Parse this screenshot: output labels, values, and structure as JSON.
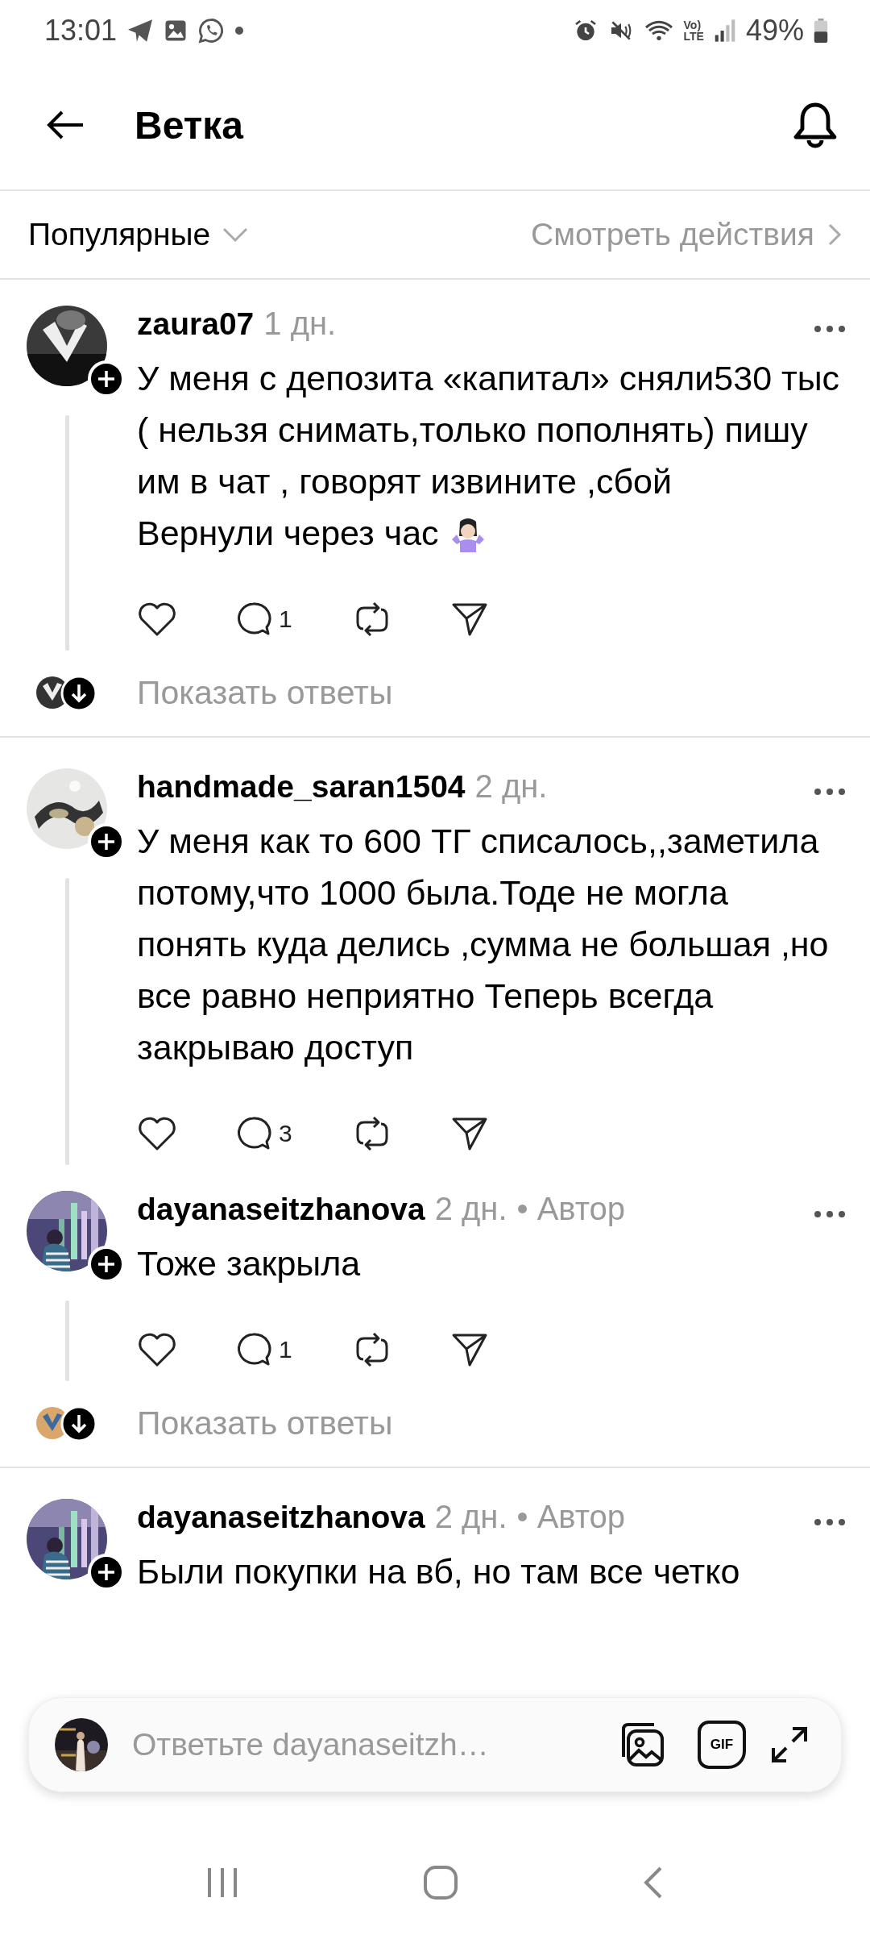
{
  "status_bar": {
    "time": "13:01",
    "network_top": "Vo)",
    "network_bottom": "LTE",
    "battery": "49%"
  },
  "header": {
    "title": "Ветка"
  },
  "sort_bar": {
    "sort_label": "Популярные",
    "activity_link": "Смотреть действия"
  },
  "comments": [
    {
      "username": "zaura07",
      "time": "1 дн.",
      "text": "У меня с депозита «капитал» сняли530 тыс ( нельзя снимать,только пополнять) пишу им в чат , говорят извините ,сбой\nВернули через час",
      "trailing_emoji": true,
      "reply_count": "1",
      "show_replies": "Показать ответы"
    },
    {
      "username": "handmade_saran1504",
      "time": "2 дн.",
      "text": "У меня как то 600 ТГ списалось,,заметила потому,что 1000 была.Тоде не могла понять куда делись ,сумма не большая ,но все равно неприятно Теперь всегда закрываю доступ",
      "reply_count": "3"
    },
    {
      "username": "dayanaseitzhanova",
      "time": "2 дн.",
      "author_badge": "• Автор",
      "text": "Тоже закрыла",
      "reply_count": "1",
      "show_replies": "Показать ответы"
    },
    {
      "username": "dayanaseitzhanova",
      "time": "2 дн.",
      "author_badge": "• Автор",
      "text": "Были покупки на вб, но там все четко"
    }
  ],
  "reply_bar": {
    "placeholder": "Ответьте dayanaseitzh…",
    "gif_label": "GIF"
  }
}
